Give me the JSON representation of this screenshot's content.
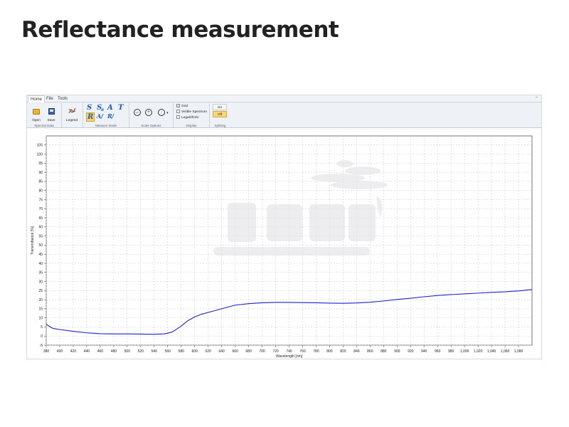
{
  "page": {
    "title": "Reflectance measurement"
  },
  "ribbon": {
    "tabs": [
      {
        "label": "Home",
        "active": true
      },
      {
        "label": "File",
        "active": false
      },
      {
        "label": "Tools",
        "active": false
      }
    ],
    "collapse_glyph": "⌃",
    "groups": {
      "spectral_data": {
        "label": "Spectral Data",
        "buttons": [
          {
            "label": "Open",
            "icon": "folder-icon"
          },
          {
            "label": "Save",
            "icon": "save-disk-icon"
          }
        ]
      },
      "legend": {
        "button_label": "Legend",
        "icon": "legend-icon"
      },
      "measure_mode": {
        "label": "Measure Mode",
        "letters_top": [
          "S",
          "S",
          "A",
          "T"
        ],
        "letters_bottom": [
          "R",
          "A",
          "R"
        ],
        "sub_top": [
          "",
          "R",
          "",
          ""
        ],
        "sub_bottom": [
          "",
          "/",
          "/"
        ],
        "active": "R"
      },
      "scale_options": {
        "label": "Scale Options",
        "icons": [
          "zoom-fit-icon",
          "zoom-in-icon",
          "zoom-menu-icon"
        ]
      },
      "display": {
        "label": "Display",
        "options": [
          {
            "label": "Grid",
            "checked": true
          },
          {
            "label": "Visible Spectrum",
            "checked": false
          },
          {
            "label": "Logarithmic",
            "checked": false
          }
        ]
      },
      "splining": {
        "label": "Splining",
        "on_label": "On",
        "off_label": "Off",
        "selected": "Off"
      }
    }
  },
  "chart_data": {
    "type": "line",
    "xlabel": "Wavelength [nm]",
    "ylabel": "Transmittance [%]",
    "xlim": [
      380,
      1100
    ],
    "ylim": [
      -5,
      110
    ],
    "x_ticks": [
      380,
      400,
      420,
      440,
      460,
      480,
      500,
      520,
      540,
      560,
      580,
      600,
      620,
      640,
      660,
      680,
      700,
      720,
      740,
      760,
      780,
      800,
      820,
      840,
      860,
      880,
      900,
      920,
      940,
      960,
      980,
      1000,
      1020,
      1040,
      1060,
      1080
    ],
    "x_tick_labels": [
      "380",
      "400",
      "420",
      "440",
      "460",
      "480",
      "500",
      "520",
      "540",
      "560",
      "580",
      "600",
      "620",
      "640",
      "660",
      "680",
      "700",
      "720",
      "740",
      "760",
      "780",
      "800",
      "820",
      "840",
      "860",
      "880",
      "900",
      "920",
      "940",
      "960",
      "980",
      "1,000",
      "1,020",
      "1,040",
      "1,060",
      "1,080"
    ],
    "y_ticks": [
      -5,
      0,
      5,
      10,
      15,
      20,
      25,
      30,
      35,
      40,
      45,
      50,
      55,
      60,
      65,
      70,
      75,
      80,
      85,
      90,
      95,
      100,
      105
    ],
    "grid": true,
    "line_color": "#1f1fcf",
    "series": [
      {
        "x": [
          380,
          385,
          390,
          400,
          420,
          440,
          460,
          480,
          500,
          520,
          540,
          555,
          565,
          570,
          580,
          590,
          600,
          610,
          620,
          640,
          660,
          680,
          700,
          720,
          740,
          760,
          780,
          800,
          820,
          840,
          860,
          880,
          900,
          920,
          940,
          960,
          980,
          1000,
          1020,
          1040,
          1060,
          1070,
          1080,
          1090,
          1100
        ],
        "y": [
          6.5,
          5.2,
          4.2,
          3.6,
          2.6,
          1.8,
          1.3,
          1.2,
          1.2,
          1.1,
          1.0,
          1.2,
          2.0,
          3.0,
          5.5,
          8.5,
          10.5,
          12.0,
          13.0,
          15.0,
          17.0,
          17.8,
          18.3,
          18.5,
          18.5,
          18.4,
          18.3,
          18.1,
          18.0,
          18.2,
          18.6,
          19.3,
          20.1,
          20.8,
          21.6,
          22.3,
          22.8,
          23.2,
          23.6,
          24.0,
          24.3,
          24.6,
          24.8,
          25.2,
          25.6
        ]
      }
    ]
  }
}
